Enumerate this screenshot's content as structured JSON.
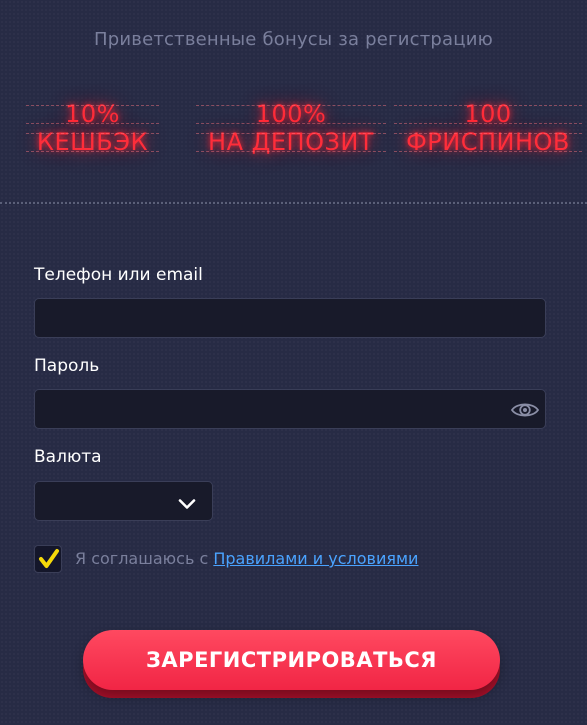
{
  "header": {
    "subtitle": "Приветственные бонусы за регистрацию"
  },
  "bonuses": [
    {
      "line1": "10%",
      "line2": "КЕШБЭК"
    },
    {
      "line1": "100%",
      "line2": "НА ДЕПОЗИТ"
    },
    {
      "line1": "100",
      "line2": "ФРИСПИНОВ"
    }
  ],
  "form": {
    "phone_label": "Телефон или email",
    "phone_value": "",
    "password_label": "Пароль",
    "password_value": "",
    "currency_label": "Валюта",
    "currency_value": "",
    "agree_prefix": "Я соглашаюсь с ",
    "agree_link": "Правилами и условиями",
    "agree_checked": true,
    "submit_label": "ЗАРЕГИСТРИРОВАТЬСЯ"
  },
  "colors": {
    "background": "#272b45",
    "neon_red": "#ff2d3a",
    "input_bg": "#181a2a",
    "link": "#4aa3ff",
    "check": "#f5d90a",
    "button": "#f12545"
  },
  "icons": {
    "password_toggle": "eye-icon",
    "currency_dropdown": "chevron-down-icon",
    "agree_check": "checkmark-icon"
  }
}
